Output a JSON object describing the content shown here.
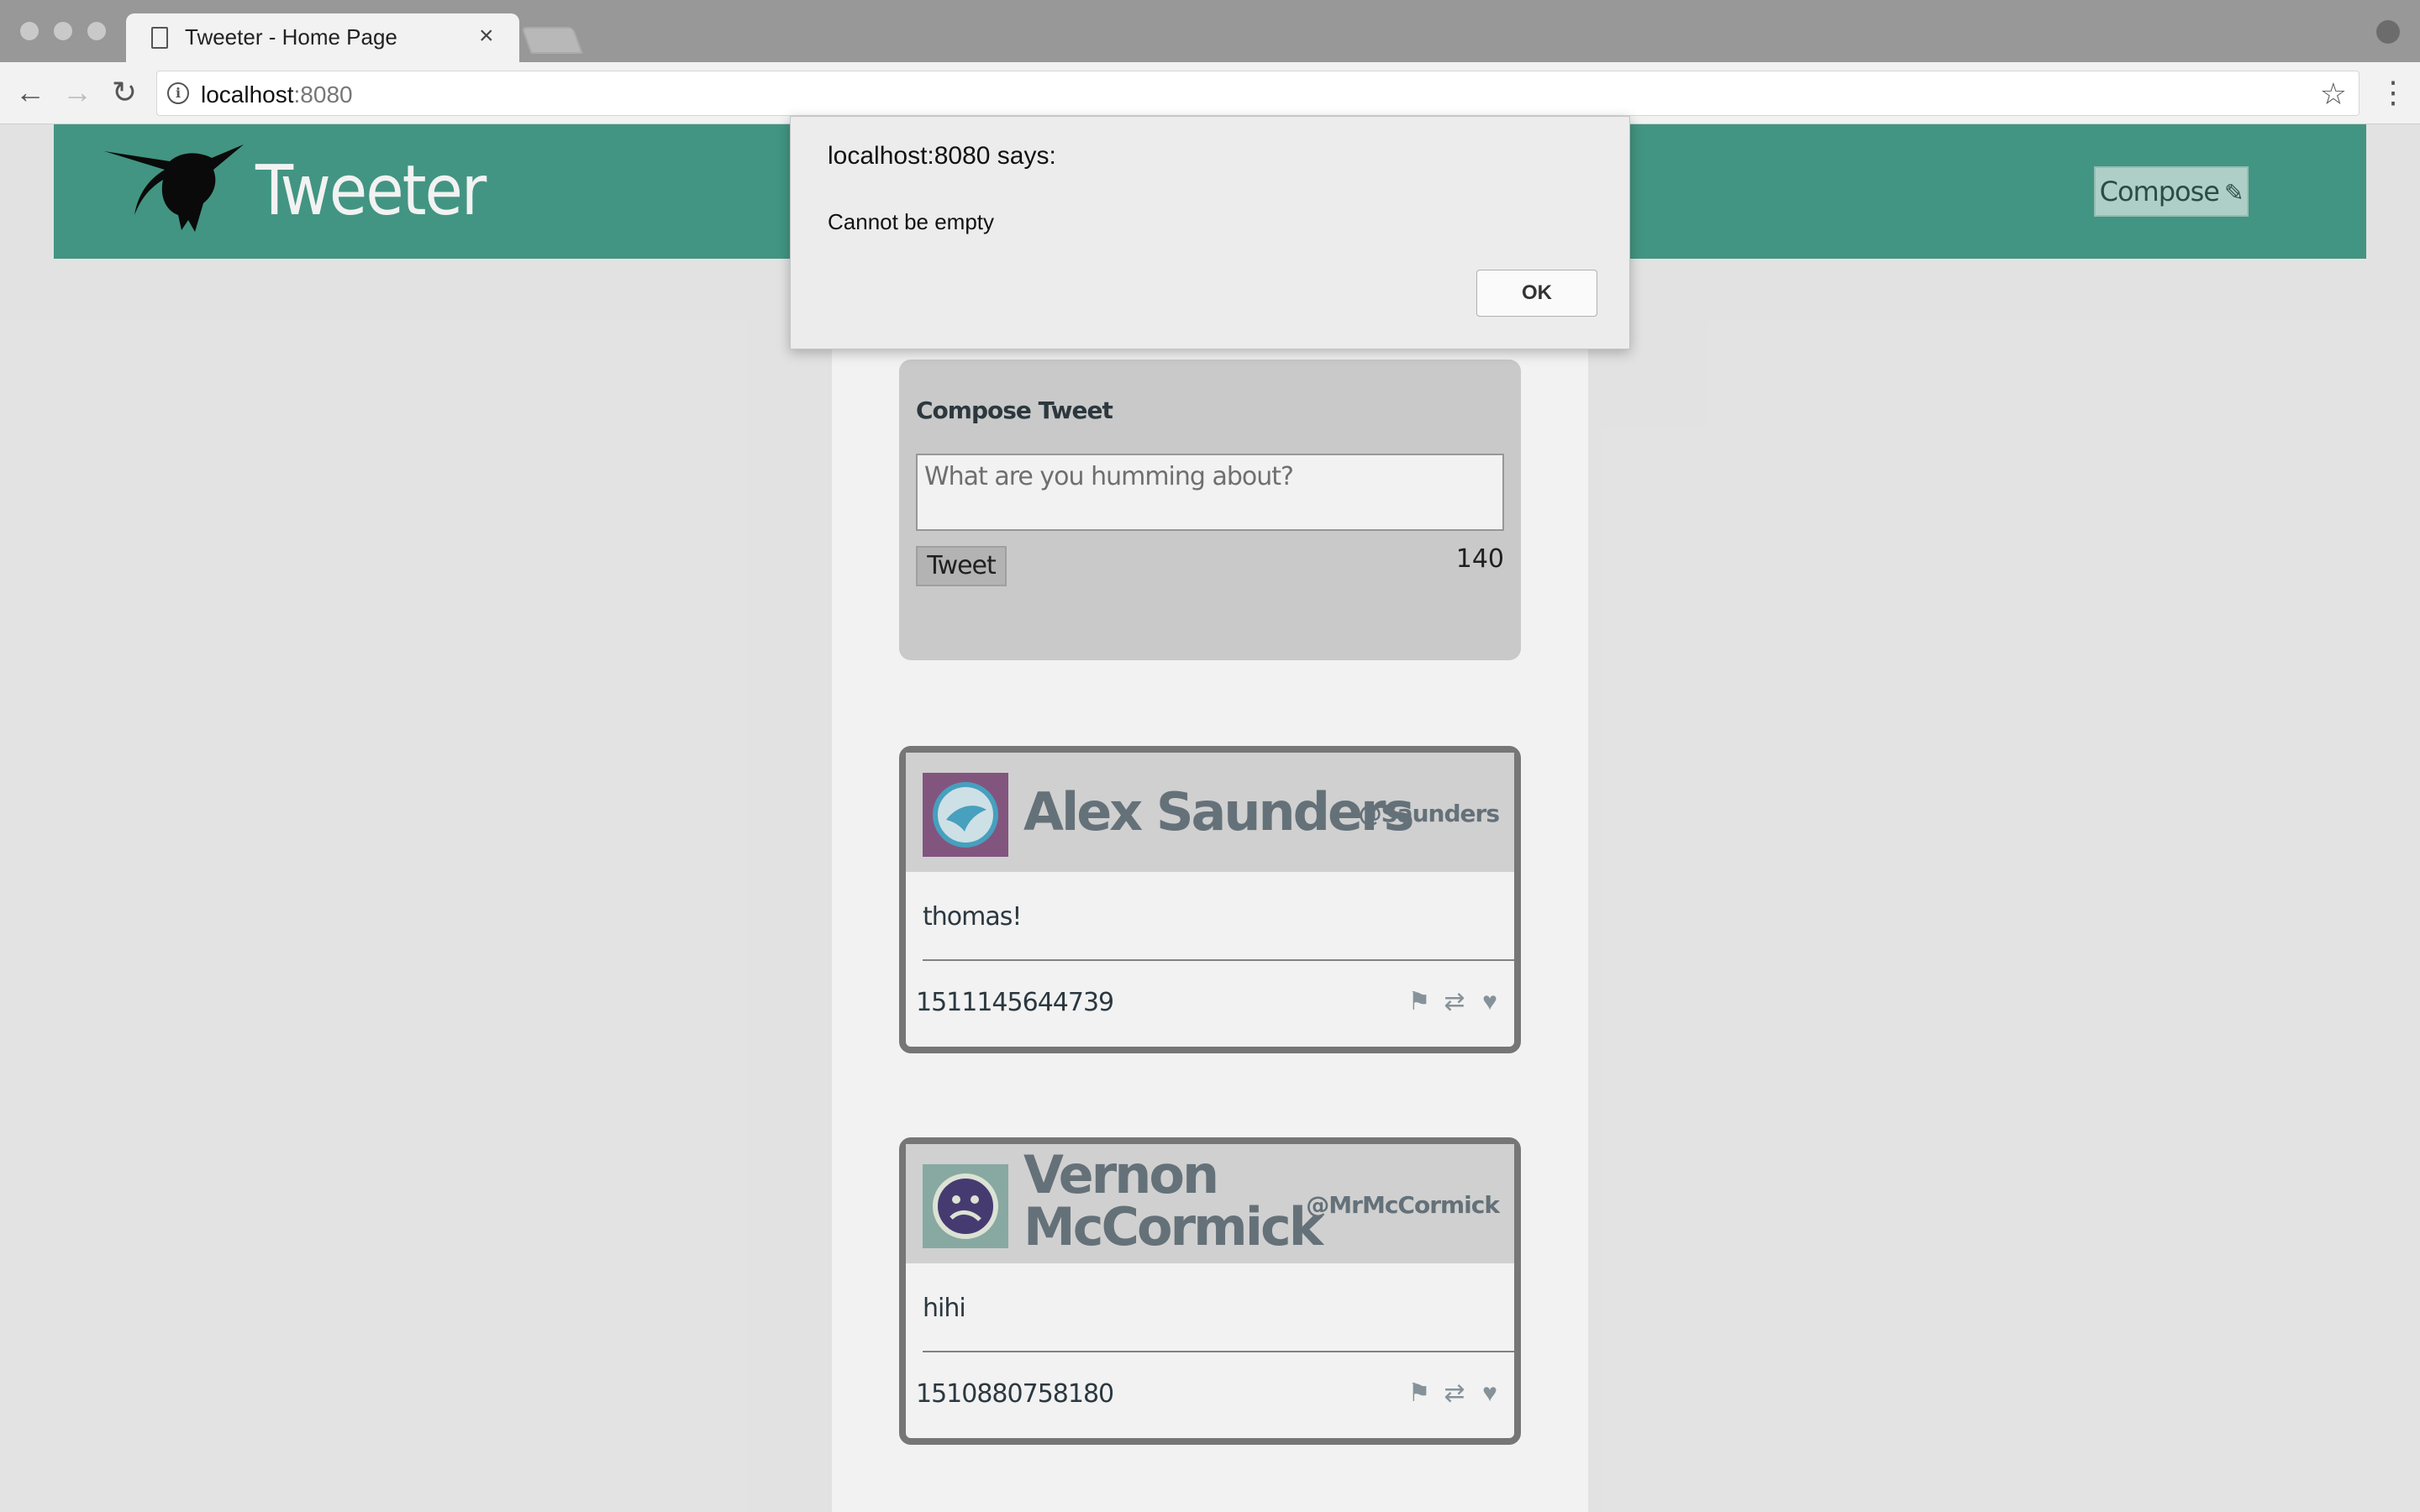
{
  "browser": {
    "tab_title": "Tweeter - Home Page",
    "tab_close": "×",
    "url_host": "localhost",
    "url_port": ":8080",
    "back": "←",
    "forward": "→",
    "reload": "↻",
    "star": "☆",
    "menu": "⋮"
  },
  "header": {
    "brand": "Tweeter",
    "compose_label": "Compose",
    "compose_icon": "✎",
    "color": "#469e8a"
  },
  "compose": {
    "heading": "Compose Tweet",
    "placeholder": "What are you humming about?",
    "button": "Tweet",
    "counter": "140"
  },
  "tweets": [
    {
      "name": "Alex Saunders",
      "handle": "@Saunders",
      "body": "thomas!",
      "time": "1511145644739"
    },
    {
      "name": "Vernon McCormick",
      "handle": "@MrMcCormick",
      "body": "hihi",
      "time": "1510880758180"
    }
  ],
  "icons": {
    "flag": "⚑",
    "retweet": "⇄",
    "like": "♥"
  },
  "alert": {
    "title": "localhost:8080 says:",
    "message": "Cannot be empty",
    "ok": "OK"
  }
}
